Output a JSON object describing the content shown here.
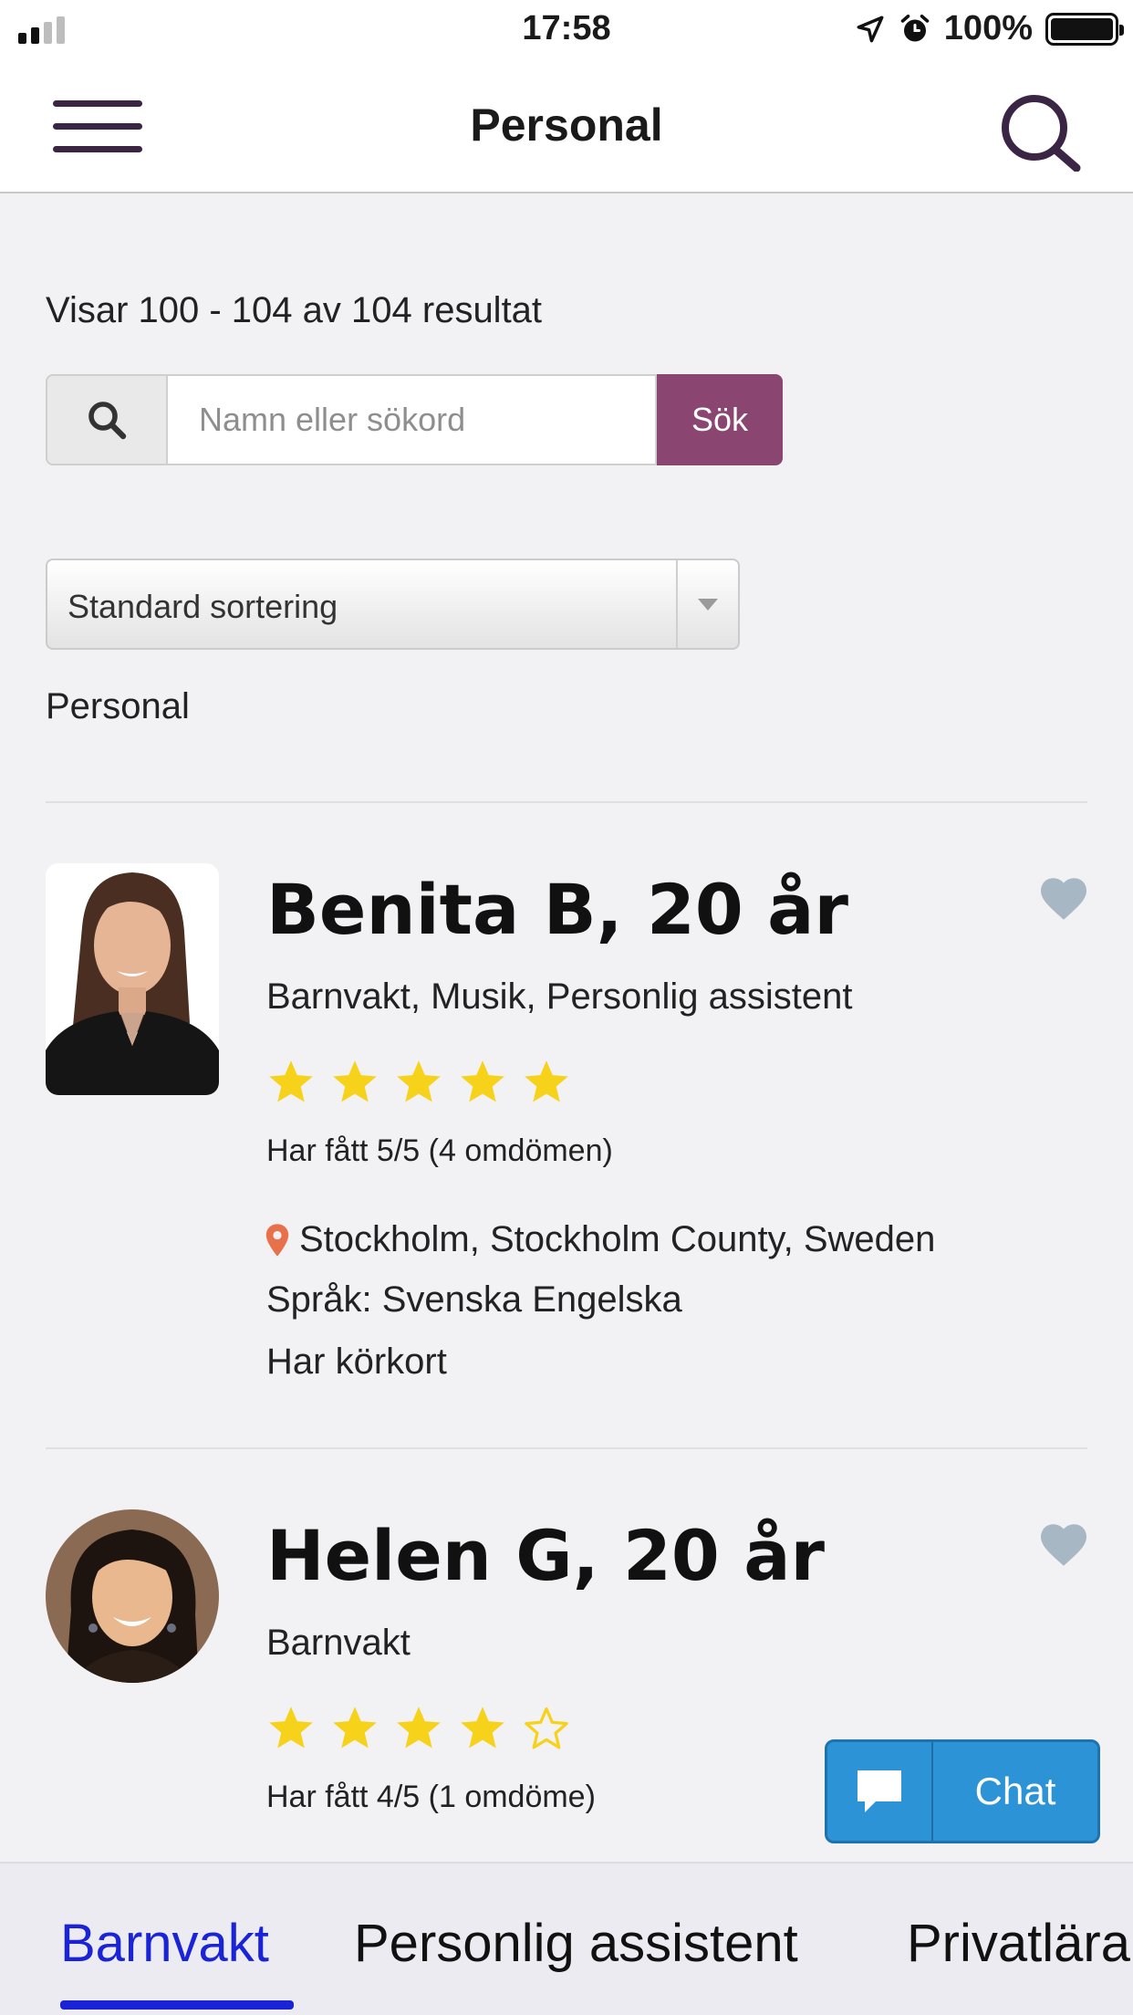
{
  "status_bar": {
    "time": "17:58",
    "battery_percent": "100%",
    "icons": [
      "signal-icon",
      "location-arrow-icon",
      "alarm-icon",
      "battery-icon"
    ]
  },
  "header": {
    "title": "Personal",
    "menu_icon": "hamburger-icon",
    "search_icon": "search-icon"
  },
  "results": {
    "summary": "Visar 100 - 104 av 104 resultat"
  },
  "search": {
    "placeholder": "Namn eller sökord",
    "value": "",
    "button_label": "Sök"
  },
  "sort": {
    "selected": "Standard sortering"
  },
  "section": {
    "label": "Personal"
  },
  "listings": [
    {
      "name": "Benita B, 20 år",
      "categories": "Barnvakt, Musik, Personlig assistent",
      "rating": 5,
      "rating_max": 5,
      "rating_text": "Har fått 5/5 (4 omdömen)",
      "location": "Stockholm, Stockholm County, Sweden",
      "languages": "Språk: Svenska Engelska",
      "license": "Har körkort"
    },
    {
      "name": "Helen G, 20 år",
      "categories": "Barnvakt",
      "rating": 4,
      "rating_max": 5,
      "rating_text": "Har fått 4/5 (1 omdöme)"
    }
  ],
  "chat": {
    "label": "Chat"
  },
  "tabs": [
    {
      "label": "Barnvakt",
      "active": true
    },
    {
      "label": "Personlig assistent",
      "active": false
    },
    {
      "label": "Privatlära",
      "active": false
    }
  ],
  "colors": {
    "brand_purple": "#8a4670",
    "star_yellow": "#f7d21b",
    "heart_gray": "#a8b7c4",
    "pin_orange": "#e8704a",
    "chat_blue": "#2c93d6",
    "tab_active": "#1a23d6"
  }
}
